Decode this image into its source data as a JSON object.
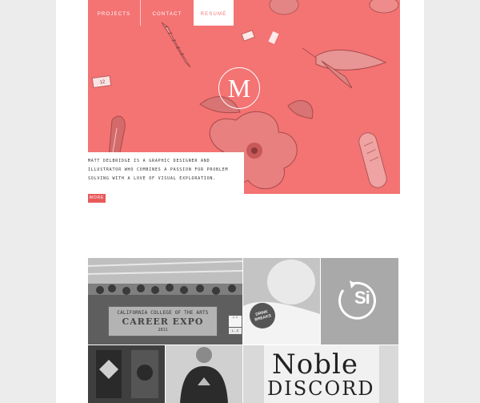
{
  "nav": {
    "items": [
      {
        "label": "PROJECTS"
      },
      {
        "label": "CONTACT"
      },
      {
        "label": "RESUME"
      }
    ]
  },
  "hero": {
    "monogram": "M",
    "tags": {
      "tag_12": "12"
    },
    "intro": "MATT DELBRIDGE IS A GRAPHIC DESIGNER AND ILLUSTRATOR WHO COMBINES A PASSION FOR PROBLEM SOLVING WITH A LOVE OF VISUAL EXPLORATION.",
    "more_label": "MORE"
  },
  "portfolio": {
    "expo": {
      "line1": "CALIFORNIA COLLEGE OF THE ARTS",
      "line2": "CAREER EXPO",
      "line3": "2011"
    },
    "sign_a": "A - K",
    "sign_b": "L - Z",
    "badge": "DRINK BREAKS",
    "si_logo": "Si",
    "noble_line1": "Noble",
    "noble_line2": "DISCORD"
  },
  "colors": {
    "accent": "#f47373",
    "button": "#e85a5a",
    "background": "#ececec"
  }
}
